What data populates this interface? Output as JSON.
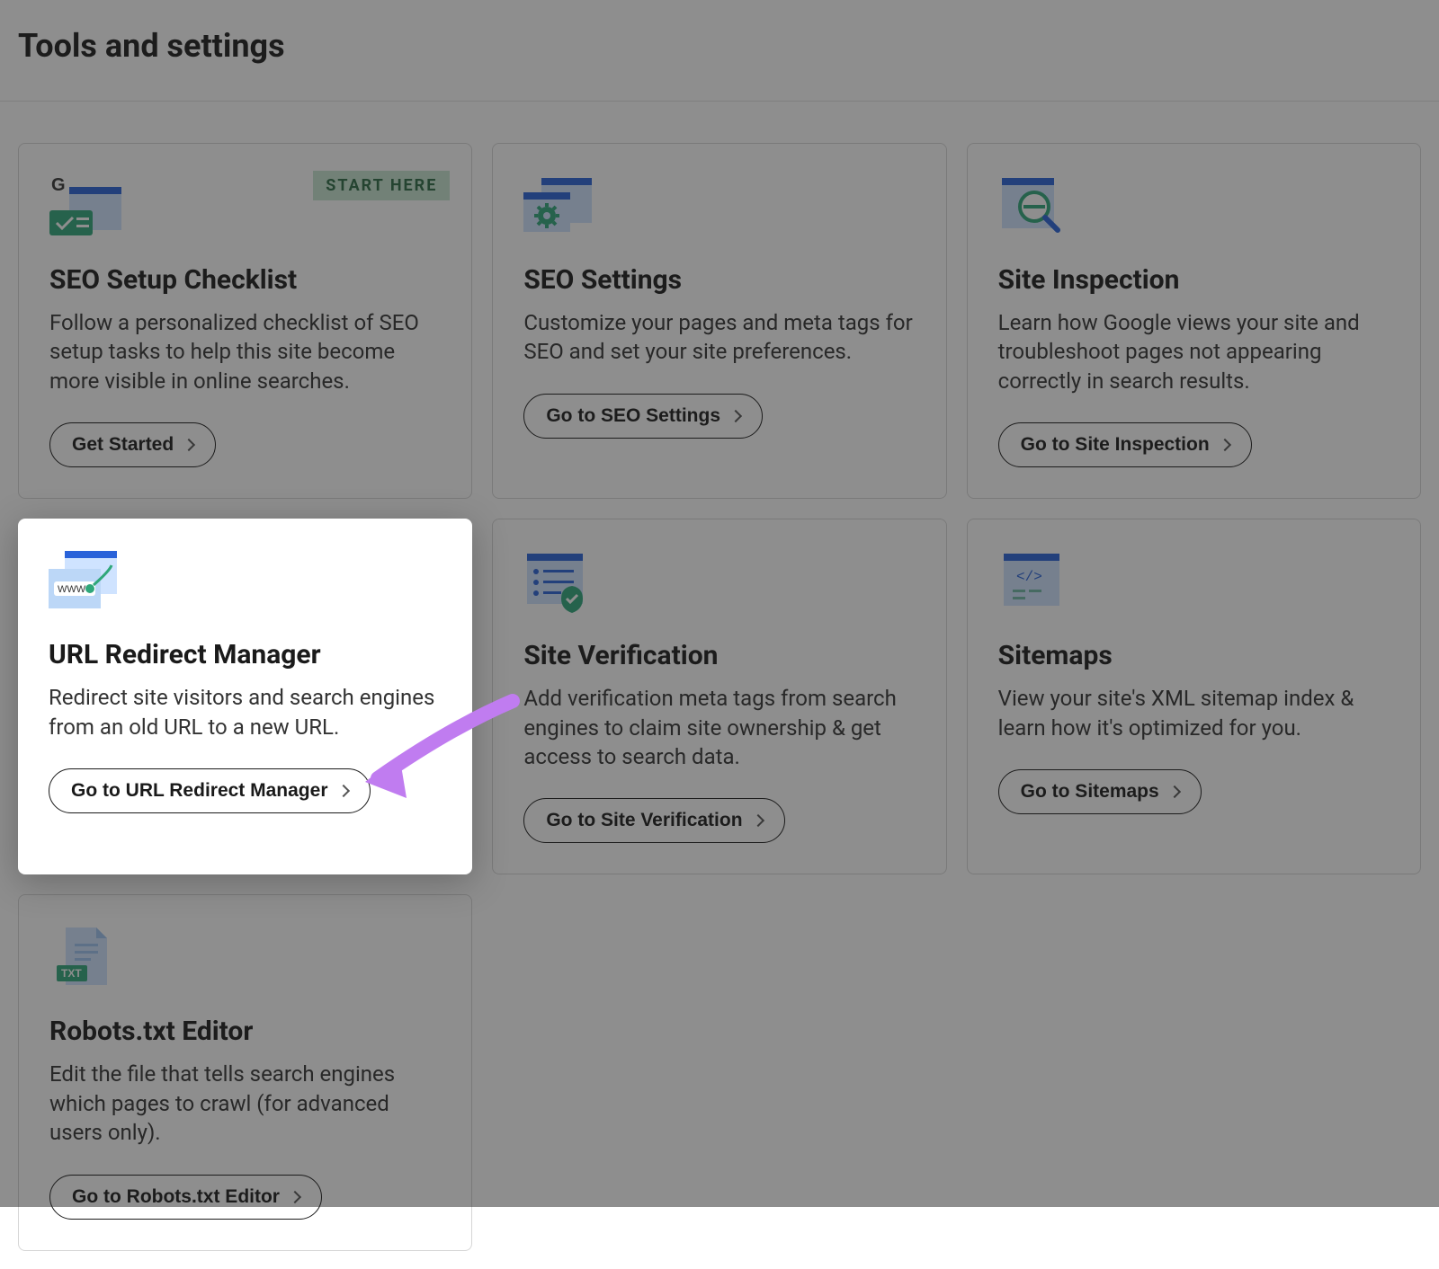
{
  "header": {
    "title": "Tools and settings"
  },
  "badge_label": "START HERE",
  "cards": [
    {
      "title": "SEO Setup Checklist",
      "desc": "Follow a personalized checklist of SEO setup tasks to help this site become more visible in online searches.",
      "button": "Get Started"
    },
    {
      "title": "SEO Settings",
      "desc": "Customize your pages and meta tags for SEO and set your site preferences.",
      "button": "Go to SEO Settings"
    },
    {
      "title": "Site Inspection",
      "desc": "Learn how Google views your site and troubleshoot pages not appearing correctly in search results.",
      "button": "Go to Site Inspection"
    },
    {
      "title": "URL Redirect Manager",
      "desc": "Redirect site visitors and search engines from an old URL to a new URL.",
      "button": "Go to URL Redirect Manager"
    },
    {
      "title": "Site Verification",
      "desc": "Add verification meta tags from search engines to claim site ownership & get access to search data.",
      "button": "Go to Site Verification"
    },
    {
      "title": "Sitemaps",
      "desc": "View your site's XML sitemap index & learn how it's optimized for you.",
      "button": "Go to Sitemaps"
    },
    {
      "title": "Robots.txt Editor",
      "desc": "Edit the file that tells search engines which pages to crawl (for advanced users only).",
      "button": "Go to Robots.txt Editor"
    }
  ]
}
